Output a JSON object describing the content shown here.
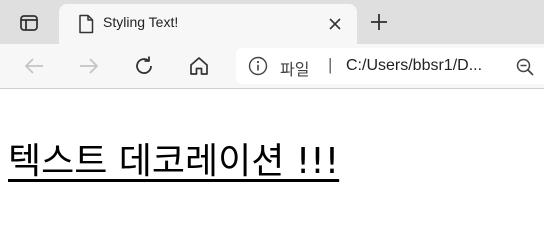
{
  "browser": {
    "tab": {
      "title": "Styling Text!"
    },
    "address_bar": {
      "site_label": "파일",
      "separator": "|",
      "url": "C:/Users/bbsr1/D..."
    }
  },
  "page": {
    "heading": "텍스트 데코레이션 !!!"
  },
  "colors": {
    "tabbar_bg": "#dfdfdf",
    "toolbar_bg": "#f7f7f7",
    "heading": "#000000"
  }
}
